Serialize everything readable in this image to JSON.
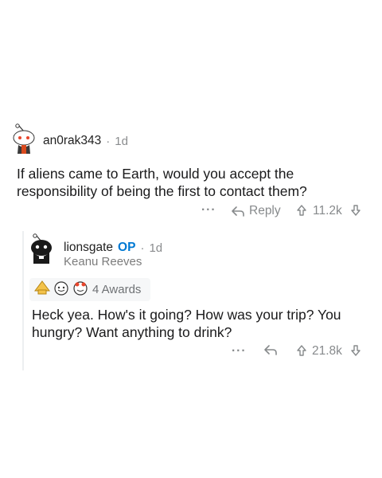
{
  "comment": {
    "username": "an0rak343",
    "separator": "·",
    "time": "1d",
    "body_line1": "If aliens came to Earth, would you accept the",
    "body_line2": "responsibility of being the first to contact them?",
    "more": "···",
    "reply_label": "Reply",
    "score": "11.2k"
  },
  "reply": {
    "username": "lionsgate",
    "op_badge": "OP",
    "separator": "·",
    "time": "1d",
    "flair": "Keanu Reeves",
    "awards_label": "4 Awards",
    "body_line1": "Heck yea. How's it going? How was your trip? You",
    "body_line2": "hungry? Want anything to drink?",
    "more": "···",
    "score": "21.8k"
  },
  "colors": {
    "accent": "#0079d3",
    "meta": "#878a8c",
    "thread_line": "#edeff1",
    "awards_bg": "#f6f7f8"
  }
}
